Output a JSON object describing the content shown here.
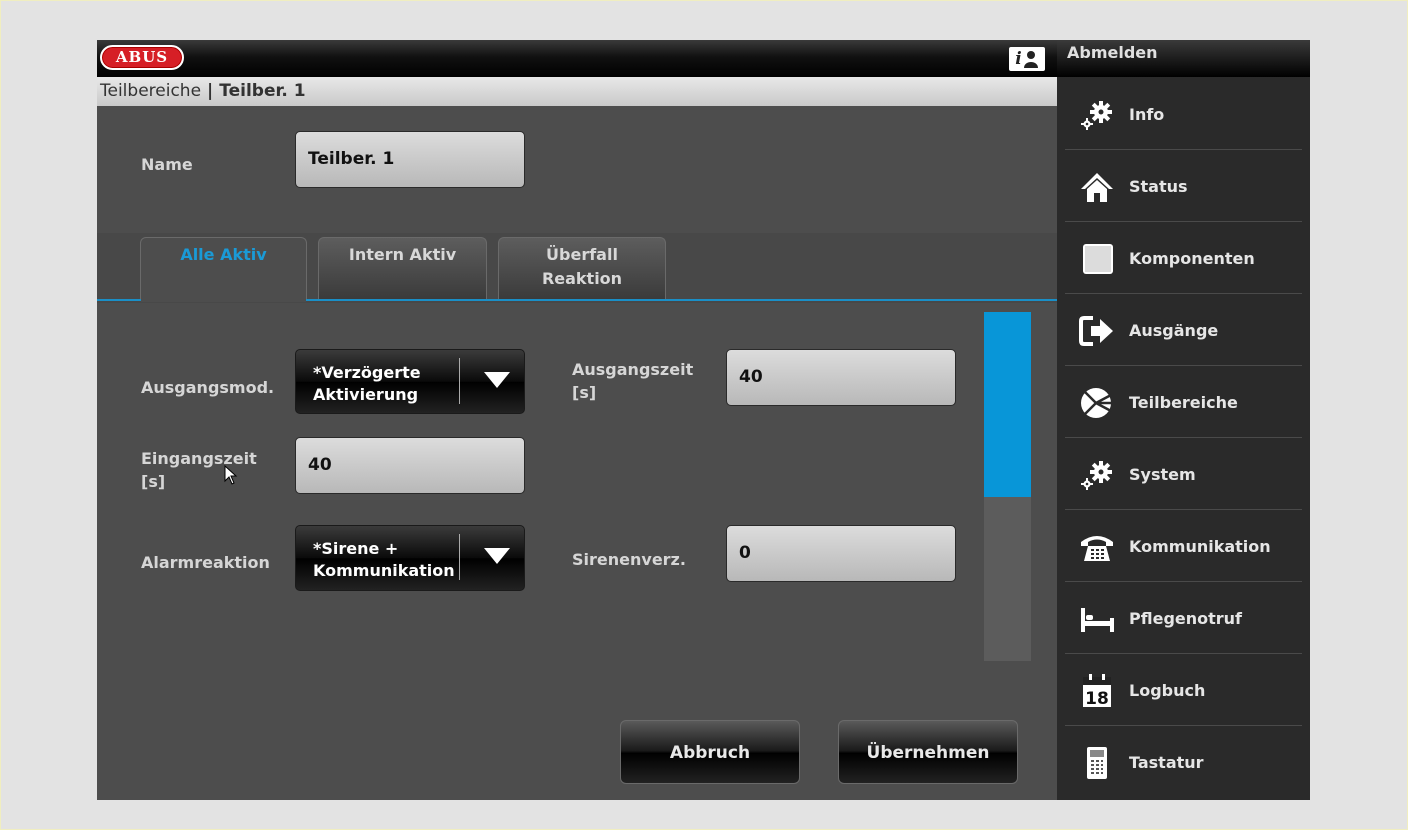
{
  "header": {
    "logo_text": "ABUS",
    "help_icon": "info-user-icon",
    "logout_label": "Abmelden"
  },
  "breadcrumb": {
    "parent": "Teilbereiche",
    "separator": "|",
    "current": "Teilber. 1"
  },
  "form": {
    "name_label": "Name",
    "name_value": "Teilber. 1"
  },
  "tabs": [
    {
      "label": "Alle Aktiv",
      "active": true
    },
    {
      "label": "Intern Aktiv",
      "active": false
    },
    {
      "label": "Überfall\nReaktion",
      "active": false
    }
  ],
  "settings": {
    "ausgangsmod_label": "Ausgangsmod.",
    "ausgangsmod_value": "*Verzögerte\nAktivierung",
    "ausgangszeit_label": "Ausgangszeit\n[s]",
    "ausgangszeit_value": "40",
    "eingangszeit_label": "Eingangszeit\n[s]",
    "eingangszeit_value": "40",
    "alarmreaktion_label": "Alarmreaktion",
    "alarmreaktion_value": "*Sirene +\nKommunikation",
    "sirenenverz_label": "Sirenenverz.",
    "sirenenverz_value": "0"
  },
  "actions": {
    "cancel_label": "Abbruch",
    "apply_label": "Übernehmen"
  },
  "sidebar": {
    "items": [
      {
        "label": "Info",
        "icon": "gears-icon"
      },
      {
        "label": "Status",
        "icon": "house-icon"
      },
      {
        "label": "Komponenten",
        "icon": "square-icon"
      },
      {
        "label": "Ausgänge",
        "icon": "exit-arrow-icon"
      },
      {
        "label": "Teilbereiche",
        "icon": "partition-icon"
      },
      {
        "label": "System",
        "icon": "gears-icon"
      },
      {
        "label": "Kommunikation",
        "icon": "telephone-icon"
      },
      {
        "label": "Pflegenotruf",
        "icon": "bed-icon"
      },
      {
        "label": "Logbuch",
        "icon": "calendar-icon"
      },
      {
        "label": "Tastatur",
        "icon": "keypad-icon"
      }
    ],
    "calendar_day": "18"
  },
  "colors": {
    "accent": "#1a9ad6",
    "logo_red": "#d61f26",
    "scroll_thumb": "#0896d8"
  }
}
